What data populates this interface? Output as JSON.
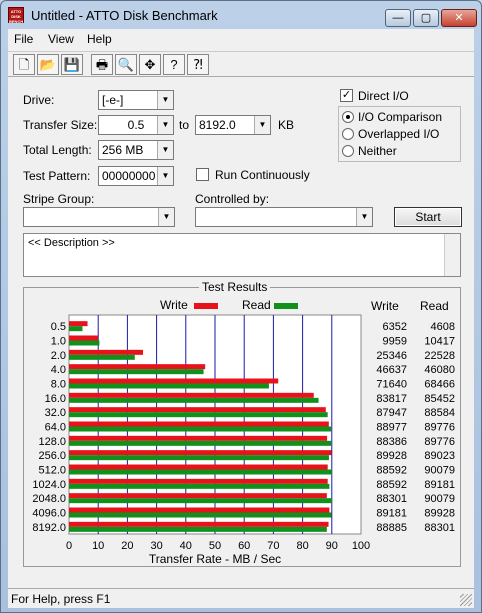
{
  "window": {
    "title": "Untitled - ATTO Disk Benchmark",
    "app_icon_text": "ATTO DISK BENCH"
  },
  "menu": [
    "File",
    "View",
    "Help"
  ],
  "toolbar_icons": [
    "new-file-icon",
    "open-folder-icon",
    "save-icon",
    "print-icon",
    "print-preview-icon",
    "move-icon",
    "help-icon",
    "context-help-icon"
  ],
  "form": {
    "drive_label": "Drive:",
    "drive_value": "[-e-]",
    "transfer_size_label": "Transfer Size:",
    "transfer_from": "0.5",
    "to_label": "to",
    "transfer_to": "8192.0",
    "kb_label": "KB",
    "total_length_label": "Total Length:",
    "total_length_value": "256 MB",
    "test_pattern_label": "Test Pattern:",
    "test_pattern_value": "00000000",
    "run_continuously_label": "Run Continuously",
    "run_continuously_checked": false,
    "stripe_group_label": "Stripe Group:",
    "stripe_group_value": "",
    "controlled_by_label": "Controlled by:",
    "controlled_by_value": "",
    "direct_io_label": "Direct I/O",
    "direct_io_checked": true,
    "io_options": [
      {
        "label": "I/O Comparison",
        "selected": true
      },
      {
        "label": "Overlapped I/O",
        "selected": false
      },
      {
        "label": "Neither",
        "selected": false
      }
    ],
    "start_label": "Start",
    "description_text": "<< Description >>"
  },
  "results": {
    "title": "Test Results",
    "write_legend": "Write",
    "read_legend": "Read",
    "write_col": "Write",
    "read_col": "Read",
    "xlabel": "Transfer Rate - MB / Sec",
    "xticks": [
      "0",
      "10",
      "20",
      "30",
      "40",
      "50",
      "60",
      "70",
      "80",
      "90",
      "100"
    ]
  },
  "chart_data": {
    "type": "bar",
    "title": "Test Results",
    "xlabel": "Transfer Rate - MB / Sec",
    "xlim": [
      0,
      100
    ],
    "grid": true,
    "legend": "top",
    "categories": [
      "0.5",
      "1.0",
      "2.0",
      "4.0",
      "8.0",
      "16.0",
      "32.0",
      "64.0",
      "128.0",
      "256.0",
      "512.0",
      "1024.0",
      "2048.0",
      "4096.0",
      "8192.0"
    ],
    "series": [
      {
        "name": "Write",
        "color": "#e8121a",
        "values": [
          6.352,
          9.959,
          25.346,
          46.637,
          71.64,
          83.817,
          87.947,
          88.977,
          88.386,
          89.928,
          88.592,
          88.592,
          88.301,
          89.181,
          88.885
        ]
      },
      {
        "name": "Read",
        "color": "#11911c",
        "values": [
          4.608,
          10.417,
          22.528,
          46.08,
          68.466,
          85.452,
          88.584,
          89.776,
          89.776,
          89.023,
          90.079,
          89.181,
          90.079,
          89.928,
          88.301
        ]
      }
    ],
    "write_text": [
      "6352",
      "9959",
      "25346",
      "46637",
      "71640",
      "83817",
      "87947",
      "88977",
      "88386",
      "89928",
      "88592",
      "88592",
      "88301",
      "89181",
      "88885"
    ],
    "read_text": [
      "4608",
      "10417",
      "22528",
      "46080",
      "68466",
      "85452",
      "88584",
      "89776",
      "89776",
      "89023",
      "90079",
      "89181",
      "90079",
      "89928",
      "88301"
    ]
  },
  "status": {
    "text": "For Help, press F1"
  },
  "colors": {
    "write": "#e8121a",
    "read": "#11911c",
    "grid": "#1a1aa8"
  }
}
